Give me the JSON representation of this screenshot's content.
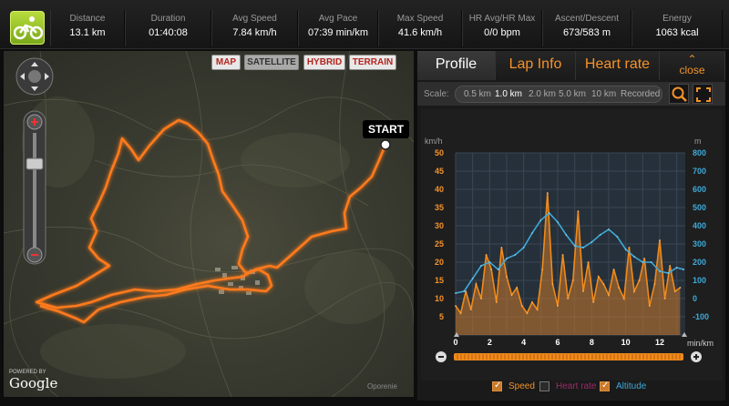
{
  "stats": [
    {
      "label": "Distance",
      "value": "13.1 km"
    },
    {
      "label": "Duration",
      "value": "01:40:08"
    },
    {
      "label": "Avg Speed",
      "value": "7.84 km/h"
    },
    {
      "label": "Avg Pace",
      "value": "07:39 min/km"
    },
    {
      "label": "Max Speed",
      "value": "41.6 km/h"
    },
    {
      "label": "HR Avg/HR Max",
      "value": "0/0 bpm"
    },
    {
      "label": "Ascent/Descent",
      "value": "673/583 m"
    },
    {
      "label": "Energy",
      "value": "1063 kcal"
    }
  ],
  "map": {
    "types": [
      "MAP",
      "SATELLITE",
      "HYBRID",
      "TERRAIN"
    ],
    "start_label": "START",
    "powered_by": "POWERED BY",
    "google": "Google",
    "copyright": "Oporenie"
  },
  "tabs": [
    "Profile",
    "Lap Info",
    "Heart rate",
    "close"
  ],
  "scale": {
    "label": "Scale:",
    "options": [
      "0.5 km",
      "1.0 km",
      "2.0 km",
      "5.0 km",
      "10 km",
      "Recorded"
    ],
    "selected": "1.0 km"
  },
  "legend": {
    "speed": "Speed",
    "heart": "Heart rate",
    "altitude": "Altitude"
  },
  "colors": {
    "accent": "#f4922a",
    "speed": "#f08a1a",
    "altitude": "#3fa9d8",
    "heart": "#9c2a6a"
  },
  "chart_data": {
    "type": "line",
    "left_unit": "km/h",
    "right_unit": "m",
    "x_unit": "min/km",
    "xlim": [
      0,
      13.5
    ],
    "xticks": [
      "0",
      "2",
      "4",
      "6",
      "8",
      "10",
      "12"
    ],
    "ylim": [
      0,
      50
    ],
    "yticks": [
      "50",
      "45",
      "40",
      "35",
      "30",
      "25",
      "20",
      "15",
      "10",
      "5"
    ],
    "y2lim": [
      -200,
      800
    ],
    "y2ticks": [
      "800",
      "700",
      "600",
      "500",
      "400",
      "300",
      "200",
      "100",
      "0",
      "-100"
    ],
    "series": [
      {
        "name": "Speed",
        "x": [
          0,
          0.3,
          0.6,
          0.9,
          1.2,
          1.5,
          1.8,
          2.1,
          2.4,
          2.7,
          3.0,
          3.3,
          3.6,
          3.9,
          4.2,
          4.5,
          4.8,
          5.1,
          5.4,
          5.7,
          6.0,
          6.3,
          6.6,
          6.9,
          7.2,
          7.5,
          7.8,
          8.1,
          8.4,
          8.7,
          9.0,
          9.3,
          9.6,
          9.9,
          10.2,
          10.5,
          10.8,
          11.1,
          11.4,
          11.7,
          12.0,
          12.3,
          12.6,
          12.9,
          13.2
        ],
        "values": [
          8,
          6,
          12,
          7,
          14,
          10,
          22,
          18,
          9,
          24,
          16,
          11,
          13,
          8,
          6,
          9,
          7,
          18,
          39,
          14,
          8,
          22,
          10,
          15,
          34,
          12,
          20,
          9,
          16,
          14,
          11,
          18,
          13,
          10,
          24,
          12,
          15,
          21,
          8,
          14,
          26,
          10,
          19,
          12,
          13
        ]
      },
      {
        "name": "Altitude",
        "x": [
          0,
          0.5,
          1,
          1.5,
          2,
          2.5,
          3,
          3.5,
          4,
          4.5,
          5,
          5.5,
          6,
          6.5,
          7,
          7.5,
          8,
          8.5,
          9,
          9.5,
          10,
          10.5,
          11,
          11.5,
          12,
          12.5,
          13,
          13.4
        ],
        "values": [
          30,
          40,
          110,
          180,
          200,
          160,
          220,
          240,
          280,
          360,
          430,
          470,
          420,
          350,
          290,
          280,
          310,
          350,
          380,
          340,
          270,
          230,
          200,
          200,
          150,
          140,
          170,
          160
        ]
      }
    ],
    "legend": [
      "Speed",
      "Heart rate",
      "Altitude"
    ]
  }
}
